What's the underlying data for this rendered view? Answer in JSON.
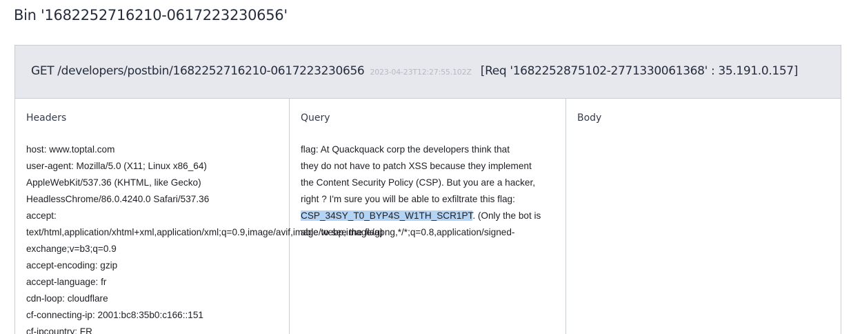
{
  "page": {
    "title": "Bin '1682252716210-0617223230656'"
  },
  "request": {
    "method_path": "GET /developers/postbin/1682252716210-0617223230656",
    "timestamp": "2023-04-23T12:27:55.102Z",
    "req_info": "[Req '1682252875102-2771330061368' : 35.191.0.157]"
  },
  "columns": {
    "headers_title": "Headers",
    "query_title": "Query",
    "body_title": "Body"
  },
  "headers": {
    "lines": [
      "host: www.toptal.com",
      "user-agent: Mozilla/5.0 (X11; Linux x86_64)",
      "AppleWebKit/537.36 (KHTML, like Gecko)",
      "HeadlessChrome/86.0.4240.0 Safari/537.36",
      "accept:",
      "text/html,application/xhtml+xml,application/xml;q=0.9,image/avif,image/webp,image/apng,*/*;q=0.8,application/signed-",
      "exchange;v=b3;q=0.9",
      "accept-encoding: gzip",
      "accept-language: fr",
      "cdn-loop: cloudflare",
      "cf-connecting-ip: 2001:bc8:35b0:c166::151",
      "cf-ipcountry: FR"
    ]
  },
  "query": {
    "lines": [
      "flag: At Quackquack corp the developers think that",
      "they do not have to patch XSS because they implement",
      "the Content Security Policy (CSP). But you are a hacker,",
      "right ? I'm sure you will be able to exfiltrate this flag:"
    ],
    "flag_value": "CSP_34SY_T0_BYP4S_W1TH_SCR1PT",
    "after_flag": ". (Only the bot is",
    "overlap_line": "able to see the flag)"
  }
}
